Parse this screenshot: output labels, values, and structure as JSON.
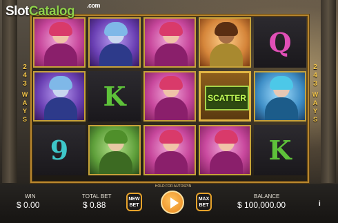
{
  "logo": {
    "slot": "Slot",
    "catalog": "Catalog",
    "com": ".com"
  },
  "ways": {
    "left": {
      "n1": "2",
      "n2": "4",
      "n3": "3",
      "w": [
        "W",
        "A",
        "Y",
        "S"
      ]
    },
    "right": {
      "n1": "2",
      "n2": "4",
      "n3": "3",
      "w": [
        "W",
        "A",
        "Y",
        "S"
      ]
    }
  },
  "reels": {
    "row1": [
      "punk-girl",
      "blue-mage",
      "punk-girl",
      "golden-girl",
      "Q"
    ],
    "row2": [
      "blue-mage",
      "K",
      "punk-girl",
      "SCATTER",
      "blue-girl"
    ],
    "row3": [
      "9",
      "green-elf",
      "punk-girl",
      "punk-girl",
      "K"
    ]
  },
  "scatter_label": "SCATTER",
  "letters": {
    "q": "Q",
    "k1": "K",
    "k2": "K",
    "nine": "9"
  },
  "letter_colors": {
    "q": "#e04fb6",
    "k": "#5ec23a",
    "nine": "#3ec7c9"
  },
  "bottom": {
    "win_label": "WIN",
    "win_value": "$ 0.00",
    "total_bet_label": "TOTAL BET",
    "total_bet_value": "$ 0.88",
    "new_bet_label": "NEW BET",
    "hold_label": "HOLD FOR AUTOSPIN",
    "max_bet_label": "MAX BET",
    "balance_label": "BALANCE",
    "balance_value": "$ 100,000.00",
    "info_icon": "i"
  },
  "colors": {
    "accent": "#e7a32b",
    "frame": "#b8862e"
  }
}
